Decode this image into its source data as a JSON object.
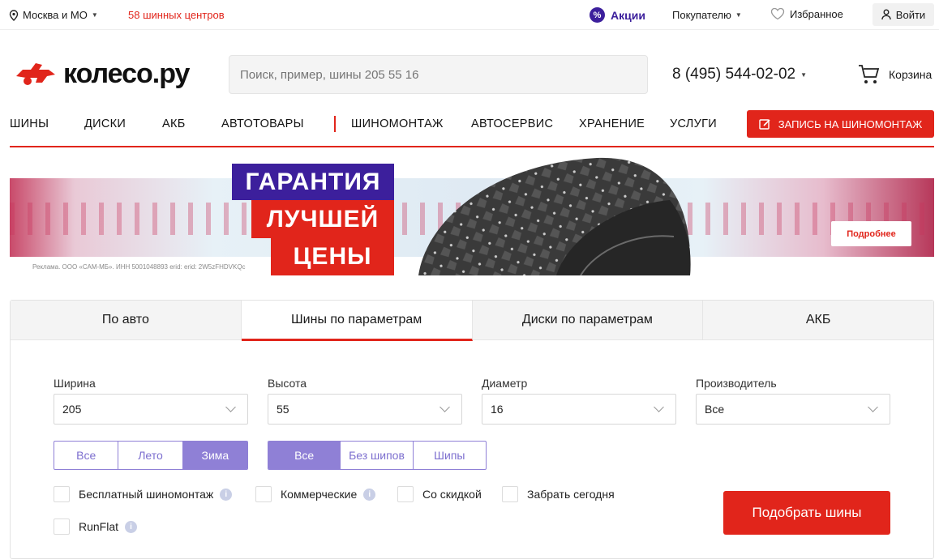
{
  "topbar": {
    "city": "Москва и МО",
    "centers": "58 шинных центров",
    "promo": "Акции",
    "buyer": "Покупателю",
    "favorites": "Избранное",
    "login": "Войти"
  },
  "header": {
    "logo": "колесо.ру",
    "search_placeholder": "Поиск, пример, шины 205 55 16",
    "phone": "8 (495) 544-02-02",
    "cart": "Корзина"
  },
  "nav": {
    "items": [
      "ШИНЫ",
      "ДИСКИ",
      "АКБ",
      "АВТОТОВАРЫ",
      "ШИНОМОНТАЖ",
      "АВТОСЕРВИС",
      "ХРАНЕНИЕ",
      "УСЛУГИ"
    ],
    "book": "ЗАПИСЬ НА ШИНОМОНТАЖ"
  },
  "banner": {
    "line1": "ГАРАНТИЯ",
    "line2": "ЛУЧШЕЙ",
    "line3": "ЦЕНЫ",
    "more": "Подробнее",
    "ad": "Реклама. ООО «САМ-МБ». ИНН 5001048893 erid: erid: 2W5zFHDVKQc"
  },
  "selector": {
    "tabs": [
      "По авто",
      "Шины по параметрам",
      "Диски по параметрам",
      "АКБ"
    ],
    "active_tab": 1,
    "fields": [
      {
        "label": "Ширина",
        "value": "205"
      },
      {
        "label": "Высота",
        "value": "55"
      },
      {
        "label": "Диаметр",
        "value": "16"
      },
      {
        "label": "Производитель",
        "value": "Все"
      }
    ],
    "season": [
      "Все",
      "Лето",
      "Зима"
    ],
    "season_selected": "Зима",
    "studs": [
      "Все",
      "Без шипов",
      "Шипы"
    ],
    "studs_selected": "Все",
    "checkboxes": [
      "Бесплатный шиномонтаж",
      "Коммерческие",
      "Со скидкой",
      "Забрать сегодня",
      "RunFlat"
    ],
    "submit": "Подобрать шины"
  },
  "colors": {
    "brand_red": "#e1251b",
    "promo_purple": "#3c1f9c",
    "toggle_violet": "#8f80d6"
  }
}
